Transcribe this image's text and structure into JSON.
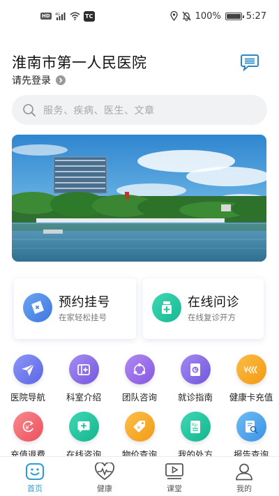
{
  "status_bar": {
    "network_badge": "HD",
    "signal_type": "4G",
    "app_badge": "TC",
    "battery_percent": "100%",
    "battery_level": 1.0,
    "time": "5:27",
    "icons": [
      "signal-icon",
      "wifi-icon",
      "location-icon",
      "mute-bell-icon",
      "battery-icon"
    ]
  },
  "header": {
    "hospital_name": "淮南市第一人民医院",
    "login_prompt": "请先登录",
    "message_icon": "message-icon"
  },
  "search": {
    "placeholder": "服务、疾病、医生、文章",
    "icon": "search-icon"
  },
  "banner": {
    "image": "hospital-lake-photo"
  },
  "quick_actions": [
    {
      "title": "预约挂号",
      "subtitle": "在家轻松挂号",
      "icon": "ticket-icon",
      "color": "#4a86e8"
    },
    {
      "title": "在线问诊",
      "subtitle": "在线复诊开方",
      "icon": "medicine-bottle-icon",
      "color": "#22c7a0"
    }
  ],
  "services": [
    {
      "label": "医院导航",
      "icon": "navigation-plane-icon",
      "color": "#6f7cf0"
    },
    {
      "label": "科室介绍",
      "icon": "department-card-icon",
      "color": "#8a6fe6"
    },
    {
      "label": "团队咨询",
      "icon": "team-icon",
      "color": "#9b6ee8"
    },
    {
      "label": "就诊指南",
      "icon": "guide-book-icon",
      "color": "#8b6de6"
    },
    {
      "label": "健康卡充值",
      "icon": "health-card-icon",
      "color": "#f6a623"
    },
    {
      "label": "充值退费",
      "icon": "refund-icon",
      "color": "#f0656d"
    },
    {
      "label": "在线咨询",
      "icon": "chat-plus-icon",
      "color": "#20c3a0"
    },
    {
      "label": "物价查询",
      "icon": "price-tag-icon",
      "color": "#f6a623"
    },
    {
      "label": "我的处方",
      "icon": "prescription-icon",
      "color": "#20c3a0"
    },
    {
      "label": "报告查询",
      "icon": "report-search-icon",
      "color": "#4aa6ef"
    }
  ],
  "tabs": [
    {
      "label": "首页",
      "icon": "home-smile-icon",
      "active": true
    },
    {
      "label": "健康",
      "icon": "heart-pulse-icon",
      "active": false
    },
    {
      "label": "课堂",
      "icon": "video-class-icon",
      "active": false
    },
    {
      "label": "我的",
      "icon": "user-icon",
      "active": false
    }
  ],
  "colors": {
    "accent": "#2c9bd6",
    "search_bg": "#f1f2f4"
  }
}
